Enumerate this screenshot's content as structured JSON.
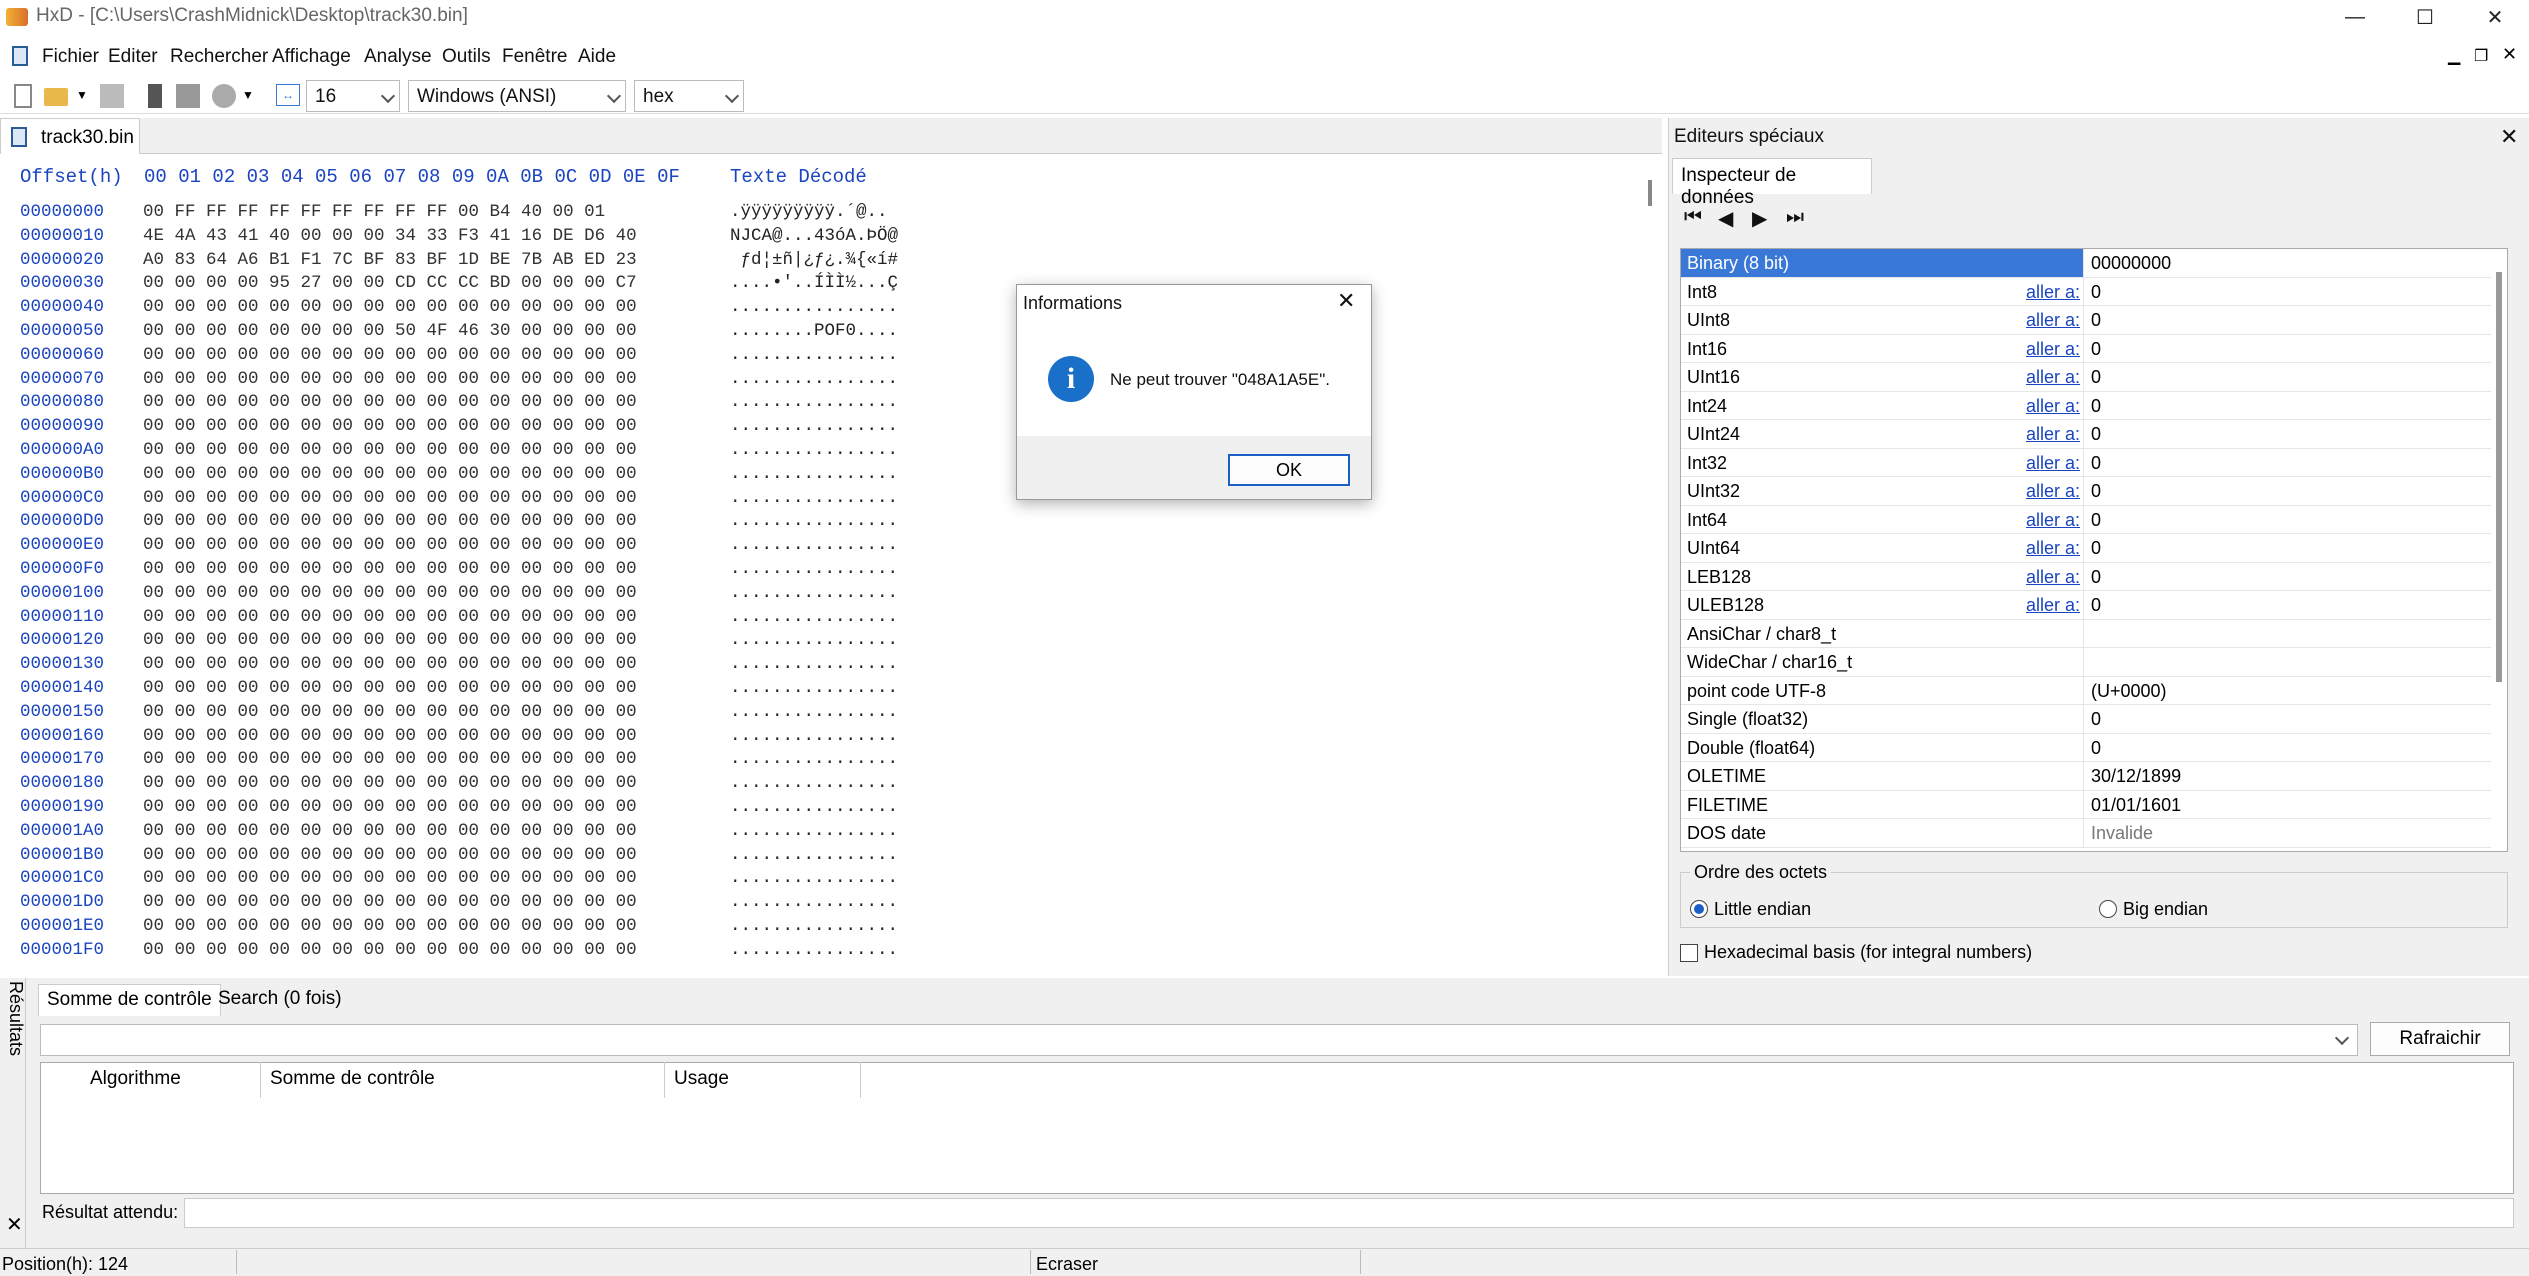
{
  "window": {
    "title": "HxD - [C:\\Users\\CrashMidnick\\Desktop\\track30.bin]",
    "min": "—",
    "max": "☐",
    "close": "✕"
  },
  "menu": [
    "Fichier",
    "Editer",
    "Rechercher",
    "Affichage",
    "Analyse",
    "Outils",
    "Fenêtre",
    "Aide"
  ],
  "toolbar": {
    "bytes_per_row": "16",
    "charset": "Windows (ANSI)",
    "display": "hex"
  },
  "file_tab": "track30.bin",
  "hex": {
    "header_offset": "Offset(h)",
    "header_cols": "00 01 02 03 04 05 06 07 08 09 0A 0B 0C 0D 0E 0F",
    "header_text": "Texte Décodé",
    "rows": [
      {
        "o": "00000000",
        "b": "00 FF FF FF FF FF FF FF FF FF 00 B4 40 00 01",
        "t": ".ÿÿÿÿÿÿÿÿÿ.´@.."
      },
      {
        "o": "00000010",
        "b": "4E 4A 43 41 40 00 00 00 34 33 F3 41 16 DE D6 40",
        "t": "NJCA@...43óA.ÞÖ@"
      },
      {
        "o": "00000020",
        "b": "A0 83 64 A6 B1 F1 7C BF 83 BF 1D BE 7B AB ED 23",
        "t": " ƒd¦±ñ|¿ƒ¿.¾{«í#"
      },
      {
        "o": "00000030",
        "b": "00 00 00 00 95 27 00 00 CD CC CC BD 00 00 00 C7",
        "t": "....•'..ÍÌÌ½...Ç"
      },
      {
        "o": "00000040",
        "b": "00 00 00 00 00 00 00 00 00 00 00 00 00 00 00 00",
        "t": "................"
      },
      {
        "o": "00000050",
        "b": "00 00 00 00 00 00 00 00 50 4F 46 30 00 00 00 00",
        "t": "........POF0...."
      },
      {
        "o": "00000060",
        "b": "00 00 00 00 00 00 00 00 00 00 00 00 00 00 00 00",
        "t": "................"
      },
      {
        "o": "00000070",
        "b": "00 00 00 00 00 00 00 00 00 00 00 00 00 00 00 00",
        "t": "................"
      },
      {
        "o": "00000080",
        "b": "00 00 00 00 00 00 00 00 00 00 00 00 00 00 00 00",
        "t": "................"
      },
      {
        "o": "00000090",
        "b": "00 00 00 00 00 00 00 00 00 00 00 00 00 00 00 00",
        "t": "................"
      },
      {
        "o": "000000A0",
        "b": "00 00 00 00 00 00 00 00 00 00 00 00 00 00 00 00",
        "t": "................"
      },
      {
        "o": "000000B0",
        "b": "00 00 00 00 00 00 00 00 00 00 00 00 00 00 00 00",
        "t": "................"
      },
      {
        "o": "000000C0",
        "b": "00 00 00 00 00 00 00 00 00 00 00 00 00 00 00 00",
        "t": "................"
      },
      {
        "o": "000000D0",
        "b": "00 00 00 00 00 00 00 00 00 00 00 00 00 00 00 00",
        "t": "................"
      },
      {
        "o": "000000E0",
        "b": "00 00 00 00 00 00 00 00 00 00 00 00 00 00 00 00",
        "t": "................"
      },
      {
        "o": "000000F0",
        "b": "00 00 00 00 00 00 00 00 00 00 00 00 00 00 00 00",
        "t": "................"
      },
      {
        "o": "00000100",
        "b": "00 00 00 00 00 00 00 00 00 00 00 00 00 00 00 00",
        "t": "................"
      },
      {
        "o": "00000110",
        "b": "00 00 00 00 00 00 00 00 00 00 00 00 00 00 00 00",
        "t": "................"
      },
      {
        "o": "00000120",
        "b": "00 00 00 00 00 00 00 00 00 00 00 00 00 00 00 00",
        "t": "................"
      },
      {
        "o": "00000130",
        "b": "00 00 00 00 00 00 00 00 00 00 00 00 00 00 00 00",
        "t": "................"
      },
      {
        "o": "00000140",
        "b": "00 00 00 00 00 00 00 00 00 00 00 00 00 00 00 00",
        "t": "................"
      },
      {
        "o": "00000150",
        "b": "00 00 00 00 00 00 00 00 00 00 00 00 00 00 00 00",
        "t": "................"
      },
      {
        "o": "00000160",
        "b": "00 00 00 00 00 00 00 00 00 00 00 00 00 00 00 00",
        "t": "................"
      },
      {
        "o": "00000170",
        "b": "00 00 00 00 00 00 00 00 00 00 00 00 00 00 00 00",
        "t": "................"
      },
      {
        "o": "00000180",
        "b": "00 00 00 00 00 00 00 00 00 00 00 00 00 00 00 00",
        "t": "................"
      },
      {
        "o": "00000190",
        "b": "00 00 00 00 00 00 00 00 00 00 00 00 00 00 00 00",
        "t": "................"
      },
      {
        "o": "000001A0",
        "b": "00 00 00 00 00 00 00 00 00 00 00 00 00 00 00 00",
        "t": "................"
      },
      {
        "o": "000001B0",
        "b": "00 00 00 00 00 00 00 00 00 00 00 00 00 00 00 00",
        "t": "................"
      },
      {
        "o": "000001C0",
        "b": "00 00 00 00 00 00 00 00 00 00 00 00 00 00 00 00",
        "t": "................"
      },
      {
        "o": "000001D0",
        "b": "00 00 00 00 00 00 00 00 00 00 00 00 00 00 00 00",
        "t": "................"
      },
      {
        "o": "000001E0",
        "b": "00 00 00 00 00 00 00 00 00 00 00 00 00 00 00 00",
        "t": "................"
      },
      {
        "o": "000001F0",
        "b": "00 00 00 00 00 00 00 00 00 00 00 00 00 00 00 00",
        "t": "................"
      }
    ]
  },
  "special": {
    "title": "Editeurs spéciaux",
    "close": "✕",
    "tab": "Inspecteur de données",
    "goto_label": "aller a:",
    "rows": [
      {
        "name": "Binary (8 bit)",
        "value": "00000000",
        "goto": false,
        "selected": true
      },
      {
        "name": "Int8",
        "value": "0",
        "goto": true
      },
      {
        "name": "UInt8",
        "value": "0",
        "goto": true
      },
      {
        "name": "Int16",
        "value": "0",
        "goto": true
      },
      {
        "name": "UInt16",
        "value": "0",
        "goto": true
      },
      {
        "name": "Int24",
        "value": "0",
        "goto": true
      },
      {
        "name": "UInt24",
        "value": "0",
        "goto": true
      },
      {
        "name": "Int32",
        "value": "0",
        "goto": true
      },
      {
        "name": "UInt32",
        "value": "0",
        "goto": true
      },
      {
        "name": "Int64",
        "value": "0",
        "goto": true
      },
      {
        "name": "UInt64",
        "value": "0",
        "goto": true
      },
      {
        "name": "LEB128",
        "value": "0",
        "goto": true
      },
      {
        "name": "ULEB128",
        "value": "0",
        "goto": true
      },
      {
        "name": "AnsiChar / char8_t",
        "value": "",
        "goto": false
      },
      {
        "name": "WideChar / char16_t",
        "value": "",
        "goto": false
      },
      {
        "name": "point code UTF-8",
        "value": " (U+0000)",
        "goto": false
      },
      {
        "name": "Single (float32)",
        "value": "0",
        "goto": false
      },
      {
        "name": "Double (float64)",
        "value": "0",
        "goto": false
      },
      {
        "name": "OLETIME",
        "value": "30/12/1899",
        "goto": false
      },
      {
        "name": "FILETIME",
        "value": "01/01/1601",
        "goto": false
      },
      {
        "name": "DOS date",
        "value": "Invalide",
        "goto": false
      }
    ],
    "byte_order_label": "Ordre des octets",
    "little_endian": "Little endian",
    "big_endian": "Big endian",
    "hex_basis": "Hexadecimal basis (for integral numbers)"
  },
  "dialog": {
    "title": "Informations",
    "message": "Ne peut trouver \"048A1A5E\".",
    "ok": "OK"
  },
  "results": {
    "side_label": "Résultats",
    "close": "✕",
    "tab_checksum": "Somme de contrôle",
    "tab_search": "Search (0 fois)",
    "refresh": "Rafraichir",
    "col_algorithm": "Algorithme",
    "col_checksum": "Somme de contrôle",
    "col_usage": "Usage",
    "expected_label": "Résultat attendu:"
  },
  "status": {
    "position": "Position(h): 124",
    "mode": "Ecraser"
  },
  "colors": {
    "accent": "#1a5fc7",
    "offset_blue": "#1a44c0",
    "selection": "#3a78d8"
  }
}
